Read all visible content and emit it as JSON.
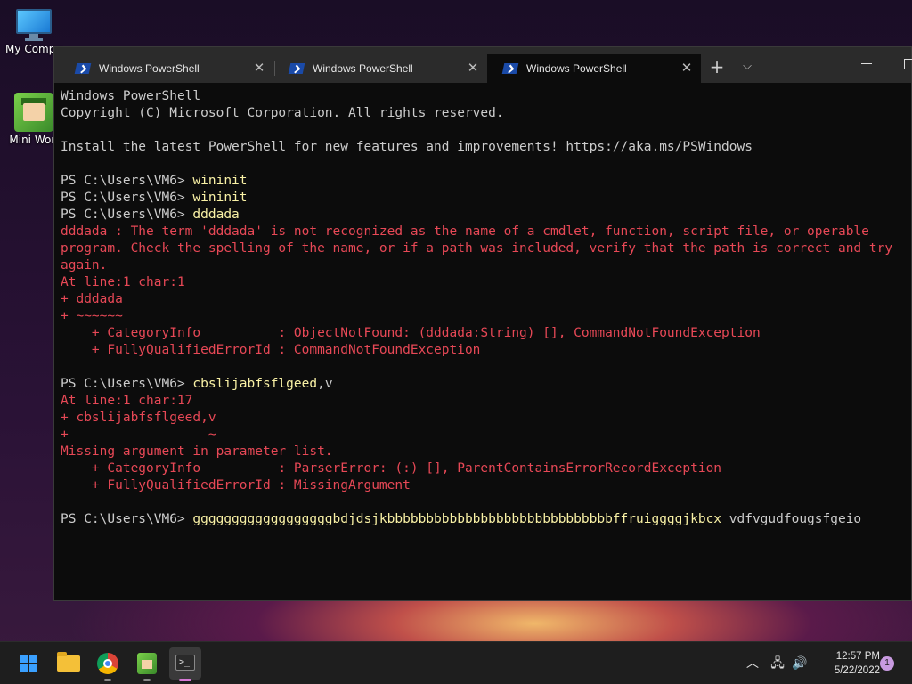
{
  "desktop": {
    "icons": [
      {
        "label": "My Compu",
        "icon": "monitor-icon"
      },
      {
        "label": "Mini Worl",
        "icon": "game-icon"
      }
    ]
  },
  "window": {
    "tabs": [
      {
        "title": "Windows PowerShell",
        "active": false
      },
      {
        "title": "Windows PowerShell",
        "active": false
      },
      {
        "title": "Windows PowerShell",
        "active": true
      }
    ],
    "close_glyph": "✕",
    "new_tab_glyph": "+",
    "dropdown_glyph": "⌵"
  },
  "terminal": {
    "lines": [
      {
        "segments": [
          {
            "text": "Windows PowerShell",
            "style": "normal"
          }
        ]
      },
      {
        "segments": [
          {
            "text": "Copyright (C) Microsoft Corporation. All rights reserved.",
            "style": "normal"
          }
        ]
      },
      {
        "segments": []
      },
      {
        "segments": [
          {
            "text": "Install the latest PowerShell for new features and improvements! https://aka.ms/PSWindows",
            "style": "normal"
          }
        ]
      },
      {
        "segments": []
      },
      {
        "segments": [
          {
            "text": "PS C:\\Users\\VM6> ",
            "style": "normal"
          },
          {
            "text": "wininit",
            "style": "cmd"
          }
        ]
      },
      {
        "segments": [
          {
            "text": "PS C:\\Users\\VM6> ",
            "style": "normal"
          },
          {
            "text": "wininit",
            "style": "cmd"
          }
        ]
      },
      {
        "segments": [
          {
            "text": "PS C:\\Users\\VM6> ",
            "style": "normal"
          },
          {
            "text": "dddada",
            "style": "cmd"
          }
        ]
      },
      {
        "segments": [
          {
            "text": "dddada : The term 'dddada' is not recognized as the name of a cmdlet, function, script file, or operable",
            "style": "err"
          }
        ]
      },
      {
        "segments": [
          {
            "text": "program. Check the spelling of the name, or if a path was included, verify that the path is correct and try",
            "style": "err"
          }
        ]
      },
      {
        "segments": [
          {
            "text": "again.",
            "style": "err"
          }
        ]
      },
      {
        "segments": [
          {
            "text": "At line:1 char:1",
            "style": "err"
          }
        ]
      },
      {
        "segments": [
          {
            "text": "+ dddada",
            "style": "err"
          }
        ]
      },
      {
        "segments": [
          {
            "text": "+ ~~~~~~",
            "style": "err"
          }
        ]
      },
      {
        "segments": [
          {
            "text": "    + CategoryInfo          : ObjectNotFound: (dddada:String) [], CommandNotFoundException",
            "style": "err"
          }
        ]
      },
      {
        "segments": [
          {
            "text": "    + FullyQualifiedErrorId : CommandNotFoundException",
            "style": "err"
          }
        ]
      },
      {
        "segments": []
      },
      {
        "segments": [
          {
            "text": "PS C:\\Users\\VM6> ",
            "style": "normal"
          },
          {
            "text": "cbslijabfsflgeed",
            "style": "cmd"
          },
          {
            "text": ",v",
            "style": "arg"
          }
        ]
      },
      {
        "segments": [
          {
            "text": "At line:1 char:17",
            "style": "err"
          }
        ]
      },
      {
        "segments": [
          {
            "text": "+ cbslijabfsflgeed,v",
            "style": "err"
          }
        ]
      },
      {
        "segments": [
          {
            "text": "+                  ~",
            "style": "err"
          }
        ]
      },
      {
        "segments": [
          {
            "text": "Missing argument in parameter list.",
            "style": "err"
          }
        ]
      },
      {
        "segments": [
          {
            "text": "    + CategoryInfo          : ParserError: (:) [], ParentContainsErrorRecordException",
            "style": "err"
          }
        ]
      },
      {
        "segments": [
          {
            "text": "    + FullyQualifiedErrorId : MissingArgument",
            "style": "err"
          }
        ]
      },
      {
        "segments": []
      },
      {
        "segments": [
          {
            "text": "PS C:\\Users\\VM6> ",
            "style": "normal"
          },
          {
            "text": "ggggggggggggggggggbdjdsjkbbbbbbbbbbbbbbbbbbbbbbbbbbbbbffruiggggjkbcx",
            "style": "cmd"
          },
          {
            "text": " vdfvgudfougsfgeio",
            "style": "arg"
          }
        ]
      }
    ]
  },
  "taskbar": {
    "apps": [
      {
        "name": "start-button",
        "icon": "windows-start-icon",
        "active": false,
        "running": false
      },
      {
        "name": "file-explorer",
        "icon": "folder-icon",
        "active": false,
        "running": false
      },
      {
        "name": "chrome",
        "icon": "chrome-icon",
        "active": false,
        "running": true
      },
      {
        "name": "mini-world",
        "icon": "game-icon",
        "active": false,
        "running": true
      },
      {
        "name": "terminal",
        "icon": "terminal-icon",
        "active": true,
        "running": true
      }
    ],
    "tray": {
      "chevron_glyph": "︿",
      "network_glyph": "🖧",
      "volume_glyph": "🔊",
      "time": "12:57 PM",
      "date": "5/22/2022",
      "notification_count": "1"
    }
  }
}
